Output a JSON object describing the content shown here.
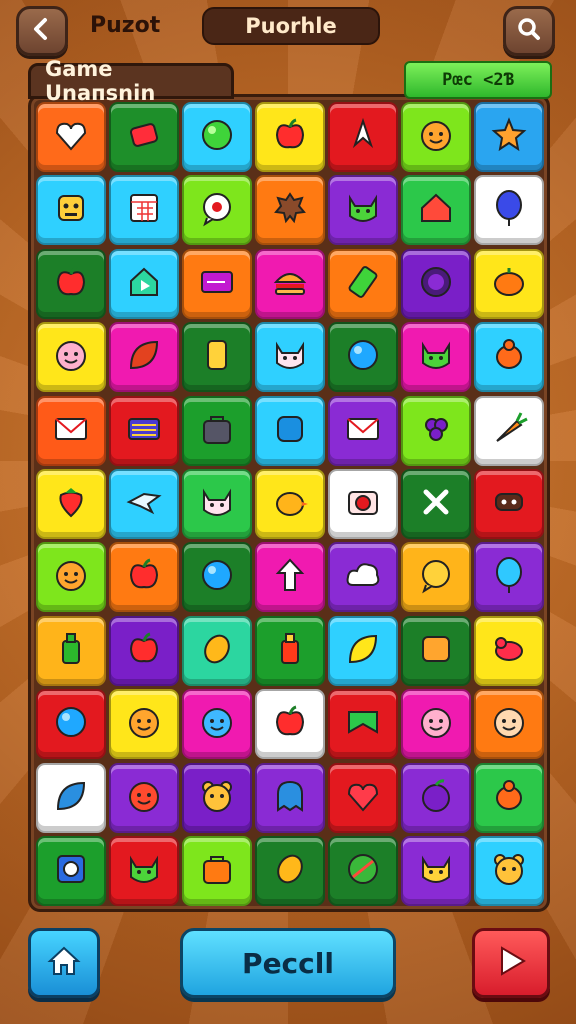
{
  "header": {
    "back_icon": "back-arrow-icon",
    "title_left": "Puzot",
    "title_center": "Puorhle",
    "search_icon": "search-icon"
  },
  "board": {
    "label": "Game Unaпsnin",
    "score_text": "Pœc <2Ɓ"
  },
  "tiles": [
    [
      {
        "bg": "#ff6a1a",
        "icon": "heart-white"
      },
      {
        "bg": "#1e8f2a",
        "icon": "candy-red"
      },
      {
        "bg": "#2fd0ff",
        "icon": "ball-green"
      },
      {
        "bg": "#ffe61a",
        "icon": "apple-red"
      },
      {
        "bg": "#e3191f",
        "icon": "bow-white"
      },
      {
        "bg": "#7ee61c",
        "icon": "face-orange"
      },
      {
        "bg": "#2aa5f0",
        "icon": "star-orange"
      }
    ],
    [
      {
        "bg": "#2fd0ff",
        "icon": "robot-face"
      },
      {
        "bg": "#2fd0ff",
        "icon": "calendar"
      },
      {
        "bg": "#7ee61c",
        "icon": "chat-red"
      },
      {
        "bg": "#ff7a12",
        "icon": "gear-dark"
      },
      {
        "bg": "#8a2bd4",
        "icon": "cat-green"
      },
      {
        "bg": "#2cc84a",
        "icon": "house-red"
      },
      {
        "bg": "#ffffff",
        "icon": "balloon-blue"
      }
    ],
    [
      {
        "bg": "#1c7f28",
        "icon": "apple-red"
      },
      {
        "bg": "#2fd0ff",
        "icon": "home-play"
      },
      {
        "bg": "#ff7a12",
        "icon": "card-purple"
      },
      {
        "bg": "#f01ab0",
        "icon": "burger"
      },
      {
        "bg": "#ff7a12",
        "icon": "battery-green"
      },
      {
        "bg": "#7a1fc8",
        "icon": "ring-purple"
      },
      {
        "bg": "#ffe61a",
        "icon": "pumpkin"
      }
    ],
    [
      {
        "bg": "#ffe61a",
        "icon": "pig-face"
      },
      {
        "bg": "#f01ab0",
        "icon": "leaf-red"
      },
      {
        "bg": "#1c7f28",
        "icon": "phone-yellow"
      },
      {
        "bg": "#2fd0ff",
        "icon": "cat-white"
      },
      {
        "bg": "#1c7f28",
        "icon": "ball-blue"
      },
      {
        "bg": "#f01ab0",
        "icon": "cat-green"
      },
      {
        "bg": "#2fd0ff",
        "icon": "bug-orange"
      }
    ],
    [
      {
        "bg": "#ff5a18",
        "icon": "mail-white"
      },
      {
        "bg": "#e3191f",
        "icon": "card-stripes"
      },
      {
        "bg": "#1c9f2c",
        "icon": "bag-grey"
      },
      {
        "bg": "#2fd0ff",
        "icon": "square-blue"
      },
      {
        "bg": "#8a2bd4",
        "icon": "mail-white"
      },
      {
        "bg": "#7ee61c",
        "icon": "grape-purple"
      },
      {
        "bg": "#ffffff",
        "icon": "carrot"
      }
    ],
    [
      {
        "bg": "#ffe61a",
        "icon": "strawberry"
      },
      {
        "bg": "#2fd0ff",
        "icon": "bird-white"
      },
      {
        "bg": "#2cc84a",
        "icon": "cat-white"
      },
      {
        "bg": "#ffe61a",
        "icon": "chick"
      },
      {
        "bg": "#ffffff",
        "icon": "camera-red"
      },
      {
        "bg": "#1c7f28",
        "icon": "cross-white"
      },
      {
        "bg": "#e3191f",
        "icon": "mask-dark"
      }
    ],
    [
      {
        "bg": "#7ee61c",
        "icon": "face-orange"
      },
      {
        "bg": "#ff7a12",
        "icon": "apple-red"
      },
      {
        "bg": "#1c7f28",
        "icon": "ball-blue"
      },
      {
        "bg": "#f01ab0",
        "icon": "arrow-up-white"
      },
      {
        "bg": "#8a2bd4",
        "icon": "cloud-white"
      },
      {
        "bg": "#ffb41a",
        "icon": "chat-yellow"
      },
      {
        "bg": "#8a2bd4",
        "icon": "balloon-cyan"
      }
    ],
    [
      {
        "bg": "#ffb41a",
        "icon": "bottle-green"
      },
      {
        "bg": "#7a1fc8",
        "icon": "apple-red"
      },
      {
        "bg": "#2cd6a0",
        "icon": "lemon"
      },
      {
        "bg": "#1c9f2c",
        "icon": "bottle-red"
      },
      {
        "bg": "#2fd0ff",
        "icon": "leaf-yellow"
      },
      {
        "bg": "#1c7f28",
        "icon": "box-orange"
      },
      {
        "bg": "#ffe61a",
        "icon": "bird-red"
      }
    ],
    [
      {
        "bg": "#e3191f",
        "icon": "ball-blue"
      },
      {
        "bg": "#ffe61a",
        "icon": "face-orange"
      },
      {
        "bg": "#f01ab0",
        "icon": "face-blue"
      },
      {
        "bg": "#ffffff",
        "icon": "apple-red"
      },
      {
        "bg": "#e3191f",
        "icon": "ribbon-green"
      },
      {
        "bg": "#f01ab0",
        "icon": "pig-face"
      },
      {
        "bg": "#ff7a12",
        "icon": "boy-face"
      }
    ],
    [
      {
        "bg": "#ffffff",
        "icon": "leaf-blue"
      },
      {
        "bg": "#8a2bd4",
        "icon": "face-red"
      },
      {
        "bg": "#7a1fc8",
        "icon": "bear-yellow"
      },
      {
        "bg": "#8a2bd4",
        "icon": "ghost-blue"
      },
      {
        "bg": "#e3191f",
        "icon": "heart-red"
      },
      {
        "bg": "#8a2bd4",
        "icon": "plum"
      },
      {
        "bg": "#2cc84a",
        "icon": "bug-orange"
      }
    ],
    [
      {
        "bg": "#1c9f2c",
        "icon": "disk-blue"
      },
      {
        "bg": "#e3191f",
        "icon": "cat-green"
      },
      {
        "bg": "#7ee61c",
        "icon": "bag-orange"
      },
      {
        "bg": "#1c7f28",
        "icon": "lemon"
      },
      {
        "bg": "#1c7f28",
        "icon": "ball-pattern"
      },
      {
        "bg": "#8a2bd4",
        "icon": "cat-yellow"
      },
      {
        "bg": "#2fd0ff",
        "icon": "bear-yellow"
      }
    ]
  ],
  "footer": {
    "home_icon": "home-icon",
    "main_button_label": "Pecсll",
    "play_icon": "play-icon"
  }
}
